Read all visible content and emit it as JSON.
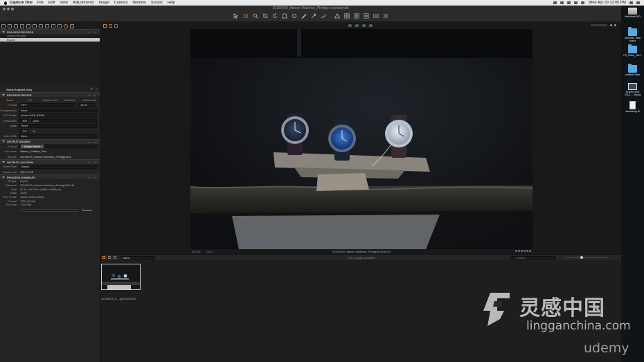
{
  "menubar": {
    "app": "Capture One",
    "items": [
      "File",
      "Edit",
      "View",
      "Adjustments",
      "Image",
      "Camera",
      "Window",
      "Scripts",
      "Help"
    ],
    "clock": "Wed Apr 29  12:05 PM"
  },
  "window": {
    "title": "20150429_Ateson-Watches_Phottgy.cosessiondb"
  },
  "left_panel": {
    "process_recipes": {
      "header": "PROCESS RECIPES",
      "items": [
        {
          "label": "Untitled Recipe",
          "selected": false
        },
        {
          "label": "Export",
          "selected": true
        }
      ],
      "show_enabled": "Show Enabled Only",
      "add": "+",
      "remove": "−"
    },
    "process_recipe": {
      "header": "PROCESS RECIPE",
      "tabs": [
        "Basic",
        "File",
        "Adjustments",
        "Metadata",
        "Watermark"
      ],
      "active_tab": "Basic",
      "format_label": "Format",
      "format_value": "TIFF",
      "format_bits": "16 bit",
      "compression_label": "Compression",
      "compression_value": "None",
      "icc_label": "ICC Profile",
      "icc_value": "Adobe RGB (1998)",
      "resolution_label": "Resolution",
      "resolution_value": "300",
      "resolution_unit": "px/in",
      "scale_label": "Scale",
      "scale_value": "Fixed",
      "scale_pct_value": "100",
      "scale_pct_unit": "%",
      "open_with_label": "Open With",
      "open_with_value": "None"
    },
    "output_naming": {
      "header": "OUTPUT NAMING",
      "format_label": "Format",
      "format_value": "Image Name",
      "job_name_label": "Job name",
      "job_name_value": "Ateson_Untitled_Test",
      "sample_label": "Sample",
      "sample_value": "20150429_Ateson-Watches_Phottgy3118"
    },
    "output_location": {
      "header": "OUTPUT LOCATION",
      "store_label": "Store Files",
      "store_value": "Output",
      "space_label": "Space Left",
      "space_value": "230.13 GB"
    },
    "process_summary": {
      "header": "PROCESS SUMMARY",
      "rows": [
        {
          "label": "Recipe",
          "value": "Export"
        },
        {
          "label": "Filename",
          "value": "20150429_Ateson-Watches_Phottgy3118.tif"
        },
        {
          "label": "Size",
          "value": "81.11 x 60.96 in (8584 x 6565 px)"
        },
        {
          "label": "Scale",
          "value": "100%"
        },
        {
          "label": "ICC Profile",
          "value": "Adobe RGB (1998)"
        },
        {
          "label": "Format",
          "value": "TIFF (16 bit)"
        },
        {
          "label": "File Size",
          "value": "~330 MB"
        }
      ],
      "process_button": "Process"
    }
  },
  "viewer": {
    "iso": "ISO 50",
    "shutter": "1/16 s",
    "filename": "20150429_Ateson-Watches_Phottgy3118.MOS"
  },
  "browser": {
    "sort_label": "Name",
    "count": "1 of 1 images selected",
    "search_placeholder": "Search",
    "thumb_name": "20150429_A....gy3118.MOS",
    "thumb_stars": "· · · · ·"
  },
  "desktop": {
    "icons": [
      {
        "type": "disk",
        "label": "Macintosh HD"
      },
      {
        "type": "folder",
        "label": "Moonrds_Wall paper"
      },
      {
        "type": "folder",
        "label": "FS_Video_Tes 1"
      },
      {
        "type": "folder",
        "label": "untitled folder"
      },
      {
        "type": "shot",
        "label": "Screen Shot 2015-....M.png"
      },
      {
        "type": "file",
        "label": "something.tif"
      }
    ]
  },
  "watermarks": {
    "cn": "灵感中国",
    "url": "lingganchina.com",
    "udemy": "udemy"
  },
  "colors": {
    "accent": "#e0792b",
    "panel": "#232323",
    "viewer": "#191919"
  }
}
